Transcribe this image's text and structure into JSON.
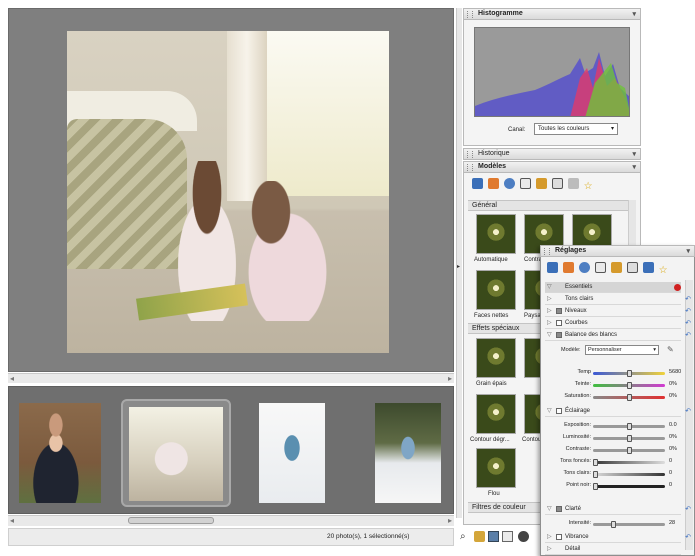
{
  "histogram": {
    "title": "Histogramme",
    "channel_label": "Canal:",
    "channel_value": "Toutes les couleurs"
  },
  "history": {
    "title": "Historique"
  },
  "models": {
    "title": "Modèles",
    "sections": {
      "general": "Général",
      "special": "Effets spéciaux",
      "filters": "Filtres de couleur"
    },
    "general_items": [
      "Automatique",
      "Contra",
      "Faces nettes",
      "Paysa"
    ],
    "special_items": [
      "Grain épais",
      "Contour dégr...",
      "Contou",
      "Flou"
    ]
  },
  "reglages": {
    "title": "Réglages",
    "rows": {
      "essentiels": "Essentiels",
      "tons_clairs": "Tons clairs",
      "niveaux": "Niveaux",
      "courbes": "Courbes",
      "balance": "Balance des blancs",
      "eclairage": "Éclairage",
      "clarte": "Clarté",
      "vibrance": "Vibrance",
      "detail": "Détail"
    },
    "model_label": "Modèle:",
    "model_value": "Personnaliser",
    "wb_sliders": [
      {
        "label": "Temp",
        "value": "5680"
      },
      {
        "label": "Teinte:",
        "value": "0%"
      },
      {
        "label": "Saturation:",
        "value": "0%"
      }
    ],
    "light_sliders": [
      {
        "label": "Exposition:",
        "value": "0.0"
      },
      {
        "label": "Luminosité:",
        "value": "0%"
      },
      {
        "label": "Contraste:",
        "value": "0%"
      },
      {
        "label": "Tons foncés:",
        "value": "0"
      },
      {
        "label": "Tons clairs:",
        "value": "0"
      },
      {
        "label": "Point noir:",
        "value": "0"
      }
    ],
    "clarity_slider": {
      "label": "Intensité:",
      "value": "28"
    }
  },
  "status": {
    "text": "20 photo(s), 1 sélectionné(s)"
  },
  "colors": {
    "accent_blue": "#3a6dc0",
    "preview_bg": "#7f7f7f",
    "filmstrip_bg": "#6f6f6f"
  }
}
